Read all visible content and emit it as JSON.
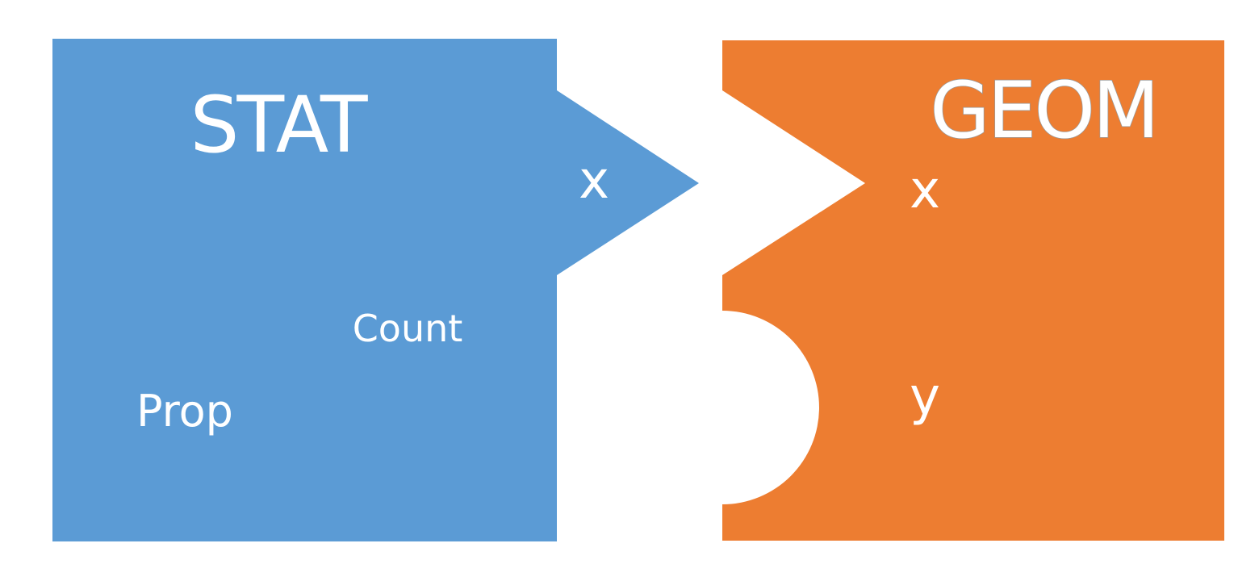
{
  "colors": {
    "stat_fill": "#5B9BD5",
    "geom_fill": "#ED7D31",
    "background": "#FFFFFF",
    "text": "#FFFFFF"
  },
  "stat": {
    "title": "STAT",
    "output_x": "x",
    "computed_count": "Count",
    "computed_prop": "Prop"
  },
  "geom": {
    "title": "GEOM",
    "input_x": "x",
    "input_y": "y"
  }
}
